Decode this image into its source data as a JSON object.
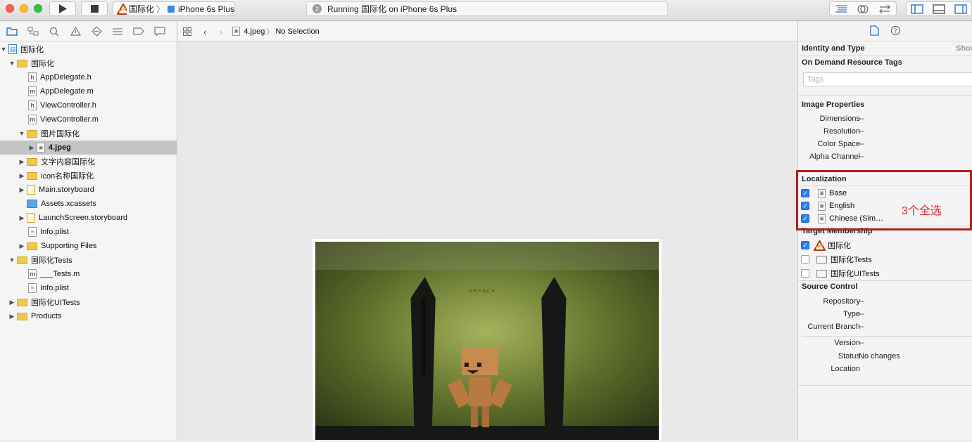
{
  "toolbar": {
    "scheme_target": "国际化",
    "scheme_device": "iPhone 6s Plus",
    "activity_badge": "2",
    "activity_text": "Running 国际化 on iPhone 6s Plus"
  },
  "navigator": {
    "items": [
      {
        "label": "国际化",
        "type": "project",
        "disclosure": "open"
      },
      {
        "label": "国际化",
        "type": "folder",
        "disclosure": "open"
      },
      {
        "label": "AppDelegate.h",
        "type": "h"
      },
      {
        "label": "AppDelegate.m",
        "type": "m"
      },
      {
        "label": "ViewController.h",
        "type": "h"
      },
      {
        "label": "ViewController.m",
        "type": "m"
      },
      {
        "label": "图片国际化",
        "type": "folder",
        "disclosure": "open"
      },
      {
        "label": "4.jpeg",
        "type": "image",
        "disclosure": "closed",
        "selected": true
      },
      {
        "label": "文字内容国际化",
        "type": "folder",
        "disclosure": "closed"
      },
      {
        "label": "icon名称国际化",
        "type": "folder",
        "disclosure": "closed"
      },
      {
        "label": "Main.storyboard",
        "type": "storyboard",
        "disclosure": "closed"
      },
      {
        "label": "Assets.xcassets",
        "type": "assets"
      },
      {
        "label": "LaunchScreen.storyboard",
        "type": "storyboard",
        "disclosure": "closed"
      },
      {
        "label": "Info.plist",
        "type": "plist"
      },
      {
        "label": "Supporting Files",
        "type": "folder",
        "disclosure": "closed"
      },
      {
        "label": "国际化Tests",
        "type": "folder",
        "disclosure": "open"
      },
      {
        "label": "___Tests.m",
        "type": "m"
      },
      {
        "label": "Info.plist",
        "type": "plist"
      },
      {
        "label": "国际化UITests",
        "type": "folder",
        "disclosure": "closed"
      },
      {
        "label": "Products",
        "type": "folder",
        "disclosure": "closed"
      }
    ]
  },
  "jumpbar": {
    "file": "4.jpeg",
    "selection": "No Selection"
  },
  "inspector": {
    "identity_title": "Identity and Type",
    "identity_show": "Show",
    "odr_title": "On Demand Resource Tags",
    "tags_placeholder": "Tags",
    "image_props_title": "Image Properties",
    "image_props": [
      {
        "key": "Dimensions",
        "value": "--"
      },
      {
        "key": "Resolution",
        "value": "--"
      },
      {
        "key": "Color Space",
        "value": "--"
      },
      {
        "key": "Alpha Channel",
        "value": "--"
      }
    ],
    "localization_title": "Localization",
    "localizations": [
      {
        "label": "Base",
        "checked": true
      },
      {
        "label": "English",
        "checked": true
      },
      {
        "label": "Chinese (Sim…",
        "checked": true
      }
    ],
    "target_title": "Target Membership",
    "targets": [
      {
        "label": "国际化",
        "checked": true
      },
      {
        "label": "国际化Tests",
        "checked": false
      },
      {
        "label": "国际化UITests",
        "checked": false
      }
    ],
    "source_title": "Source Control",
    "source_props": [
      {
        "key": "Repository",
        "value": "--"
      },
      {
        "key": "Type",
        "value": "--"
      },
      {
        "key": "Current Branch",
        "value": "--"
      }
    ],
    "version_props": [
      {
        "key": "Version",
        "value": "--"
      },
      {
        "key": "Status",
        "value": "No changes"
      },
      {
        "key": "Location",
        "value": ""
      }
    ]
  },
  "annotation": {
    "text": "3个全选",
    "color": "#e0262a"
  },
  "photo": {
    "watermark": "DRENCH"
  }
}
